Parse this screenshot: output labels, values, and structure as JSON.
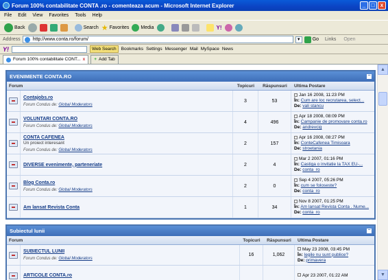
{
  "window": {
    "title": "Forum 100% contabilitate CONTA .ro - comenteaza acum - Microsoft Internet Explorer",
    "buttons": [
      "_",
      "□",
      "x"
    ]
  },
  "menu": [
    "File",
    "Edit",
    "View",
    "Favorites",
    "Tools",
    "Help"
  ],
  "toolbar": {
    "back": "Back",
    "search": "Search",
    "favorites": "Favorites",
    "media": "Media"
  },
  "address": {
    "label": "Address",
    "url": "http://www.conta.ro/forum/",
    "go": "Go",
    "links": "Links",
    "open": "Open"
  },
  "yahoo": {
    "logo": "Y!",
    "web_search": "Web Search",
    "items": [
      "Bookmarks",
      "Settings",
      "Messenger",
      "Mail",
      "MySpace",
      "News"
    ]
  },
  "tabs": {
    "active": "Forum 100% contabilitate CONT...",
    "add": "Add Tab"
  },
  "colors": {
    "category_header": "#3e6fb8",
    "link": "#123a86"
  },
  "categories": [
    {
      "title": "EVENIMENTE CONTA.RO",
      "cols": {
        "forum": "Forum",
        "topics": "Topicuri",
        "replies": "Răspunsuri",
        "last": "Ultima Postare"
      },
      "rows": [
        {
          "name": "Contajobs.ro",
          "desc": "",
          "mod_label": "Forum Condus de:",
          "mod": "Global Moderators",
          "topics": "3",
          "replies": "53",
          "date": "Jan 16 2008, 11:23 PM",
          "in_label": "În:",
          "in": "Cum are loc recrutarea, select...",
          "by_label": "De:",
          "by": "vali stancu"
        },
        {
          "name": "VOLUNTARI CONTA.RO",
          "desc": "",
          "mod_label": "Forum Condus de:",
          "mod": "Global Moderators",
          "topics": "4",
          "replies": "496",
          "date": "Apr 18 2008, 08:09 PM",
          "in_label": "În:",
          "in": "Campanie de promovare conta.ro",
          "by_label": "De:",
          "by": "andrevcig"
        },
        {
          "name": "CONTA CAFENEA",
          "desc": "Un proiect interesant",
          "mod_label": "Forum Condus de:",
          "mod": "Global Moderators",
          "topics": "2",
          "replies": "157",
          "date": "Apr 16 2008, 08:27 PM",
          "in_label": "În:",
          "in": "ConteCafenea Timisoara",
          "by_label": "De:",
          "by": "stroetania"
        },
        {
          "name": "DIVERSE evenimente, parteneriate",
          "desc": "",
          "mod_label": "",
          "mod": "",
          "topics": "2",
          "replies": "4",
          "date": "Mar 2 2007, 01:16 PM",
          "in_label": "În:",
          "in": "Castiga o invitatie la TAX EU-...",
          "by_label": "De:",
          "by": "conta_ro"
        },
        {
          "name": "Blog Conta.ro",
          "desc": "",
          "mod_label": "Forum Condus de:",
          "mod": "Global Moderators",
          "topics": "2",
          "replies": "0",
          "date": "Sep 4 2007, 05:26 PM",
          "in_label": "În:",
          "in": "cum se foloseste?",
          "by_label": "De:",
          "by": "conta_ro"
        },
        {
          "name": "Am lansat Revista Conta",
          "desc": "",
          "mod_label": "",
          "mod": "",
          "topics": "1",
          "replies": "34",
          "date": "Nov 8 2007, 01:25 PM",
          "in_label": "În:",
          "in": "Am lansat Revista Conta . Nume...",
          "by_label": "De:",
          "by": "conta_ro"
        }
      ]
    },
    {
      "title": "Subiectul lunii",
      "cols": {
        "forum": "Forum",
        "topics": "Topicuri",
        "replies": "Răspunsuri",
        "last": "Ultima Postare"
      },
      "rows": [
        {
          "name": "SUBIECTUL LUNII",
          "desc": "",
          "mod_label": "Forum Condus de:",
          "mod": "Global Moderators",
          "topics": "16",
          "replies": "1,062",
          "date": "May 23 2008, 03:45 PM",
          "in_label": "În:",
          "in": "legile nu sunt publice?",
          "by_label": "De:",
          "by": "primavera"
        },
        {
          "name": "ARTICOLE CONTA.ro",
          "desc": "",
          "mod_label": "",
          "mod": "",
          "topics": "",
          "replies": "",
          "date": "Apr 23 2007, 01:22 AM",
          "in_label": "",
          "in": "",
          "by_label": "",
          "by": ""
        }
      ]
    }
  ]
}
